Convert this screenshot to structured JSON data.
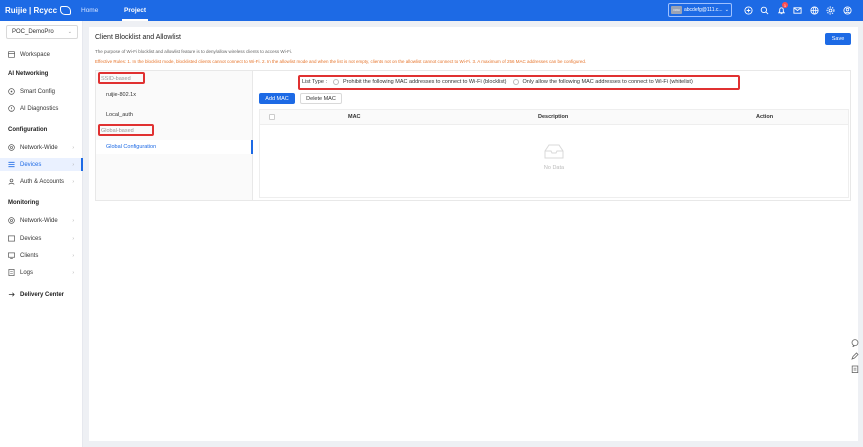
{
  "app": {
    "brand": "Ruijie | Rcycc"
  },
  "topnav": {
    "home": "Home",
    "project": "Project"
  },
  "user": {
    "avatar_text": "Orbit",
    "name": "abcdefg@111.c..."
  },
  "notifications": {
    "count": "1"
  },
  "sidebar": {
    "project": "POC_DemoPro",
    "workspace": "Workspace",
    "sections": {
      "ai_networking": "AI Networking",
      "configuration": "Configuration",
      "monitoring": "Monitoring"
    },
    "items": {
      "smart_config": "Smart Config",
      "ai_diagnostics": "AI Diagnostics",
      "cfg_network_wide": "Network-Wide",
      "cfg_devices": "Devices",
      "auth_accounts": "Auth & Accounts",
      "mon_network_wide": "Network-Wide",
      "mon_devices": "Devices",
      "clients": "Clients",
      "logs": "Logs",
      "delivery_center": "Delivery Center"
    }
  },
  "page": {
    "title": "Client Blocklist and Allowlist",
    "save": "Save",
    "description": "The purpose of Wi-Fi blocklist and allowlist feature is to deny/allow wireless clients to access Wi-Fi.",
    "rules": "Effective Rules: 1. In the blocklist mode, blocklisted clients cannot connect to Wi-Fi. 2. In the allowlist mode and when the list is not empty, clients not on the allowlist cannot connect to Wi-Fi. 3. A maximum of 256 MAC addresses can be configured."
  },
  "tree": {
    "ssid_based": "SSID-based",
    "ssid_items": [
      "ruijie-802.1x",
      "Local_auth"
    ],
    "global_based": "Global-based",
    "global_item": "Global Configuration"
  },
  "list_type": {
    "label": "List Type :",
    "blocklist": "Prohibit the following MAC addresses to connect to Wi-Fi (blocklist)",
    "allowlist": "Only allow the following MAC addresses to connect to Wi-Fi (whitelist)"
  },
  "actions": {
    "add": "Add MAC",
    "delete": "Delete MAC"
  },
  "table": {
    "columns": {
      "mac": "MAC",
      "description": "Description",
      "action": "Action"
    },
    "empty": "No Data"
  },
  "colors": {
    "primary": "#1d6ae5",
    "highlight": "#e03131",
    "warning": "#e6742b"
  }
}
